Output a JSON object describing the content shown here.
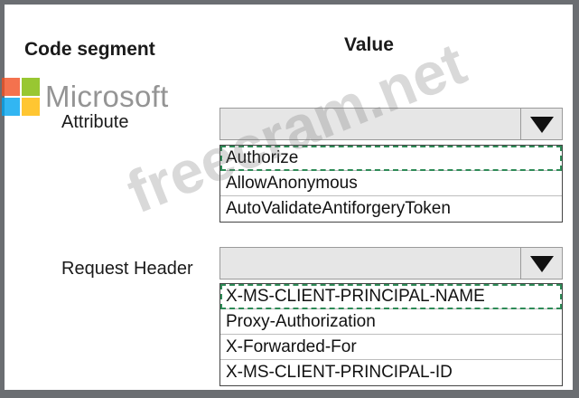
{
  "headers": {
    "code_segment": "Code segment",
    "value": "Value"
  },
  "logo": {
    "text": "Microsoft",
    "colors": [
      "#f25022",
      "#7fba00",
      "#00a4ef",
      "#ffb900"
    ]
  },
  "watermark": "freecram.net",
  "rows": [
    {
      "label": "Attribute",
      "options": [
        "Authorize",
        "AllowAnonymous",
        "AutoValidateAntiforgeryToken"
      ],
      "selected": "Authorize"
    },
    {
      "label": "Request Header",
      "options": [
        "X-MS-CLIENT-PRINCIPAL-NAME",
        "Proxy-Authorization",
        "X-Forwarded-For",
        "X-MS-CLIENT-PRINCIPAL-ID"
      ],
      "selected": "X-MS-CLIENT-PRINCIPAL-NAME"
    }
  ]
}
